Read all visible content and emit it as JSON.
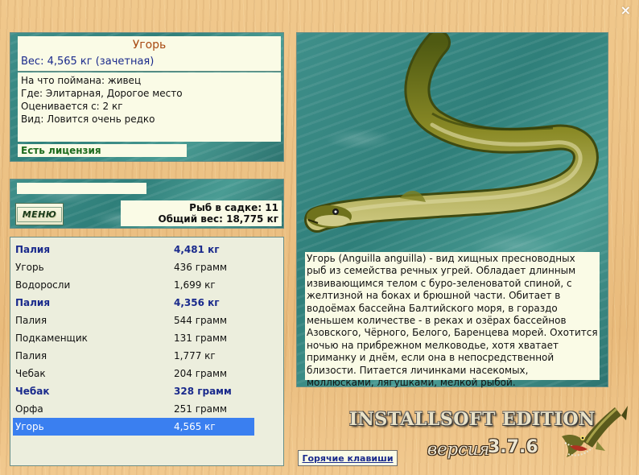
{
  "window": {
    "close_symbol": "×"
  },
  "fish_info": {
    "name": "Угорь",
    "weight": "Вес: 4,565 кг (зачетная)",
    "details": [
      "На что поймана: живец",
      "Где: Элитарная, Дорогое место",
      "Оценивается с: 2 кг",
      "Вид: Ловится очень редко"
    ],
    "license": "Есть лицензия"
  },
  "menu": {
    "button_label": "МЕНЮ",
    "fish_in_cage": "Рыб в садке: 11",
    "total_weight": "Общий вес: 18,775 кг"
  },
  "catch_list": [
    {
      "name": "Палия",
      "weight": "4,481 кг",
      "bold": true
    },
    {
      "name": "Угорь",
      "weight": "436 грамм",
      "bold": false
    },
    {
      "name": "Водоросли",
      "weight": "1,699 кг",
      "bold": false
    },
    {
      "name": "Палия",
      "weight": "4,356 кг",
      "bold": true
    },
    {
      "name": "Палия",
      "weight": "544 грамм",
      "bold": false
    },
    {
      "name": "Подкаменщик",
      "weight": "131 грамм",
      "bold": false
    },
    {
      "name": "Палия",
      "weight": "1,777 кг",
      "bold": false
    },
    {
      "name": "Чебак",
      "weight": "204 грамм",
      "bold": false
    },
    {
      "name": "Чебак",
      "weight": "328 грамм",
      "bold": true
    },
    {
      "name": "Орфа",
      "weight": "251 грамм",
      "bold": false
    },
    {
      "name": "Угорь",
      "weight": "4,565 кг",
      "bold": false,
      "selected": true
    }
  ],
  "description": "Угорь (Anguilla anguilla) - вид хищных пресноводных рыб из семейства речных угрей. Обладает длинным извивающимся телом с буро-зеленоватой спиной, с желтизной на боках и брюшной части. Обитает в водоёмах бассейна Балтийского моря, в гораздо меньшем количестве - в реках и озёрах бассейнов Азовского, Чёрного, Белого, Баренцева морей. Охотится ночью на прибрежном мелководье, хотя хватает приманку и днём, если она в непосредственной близости. Питается личинками насекомых, моллюсками, лягушками, мелкой рыбой.",
  "hotkeys_label": "Горячие клавиши",
  "branding": {
    "edition": "INSTALLSOFT EDITION",
    "version_label": "версия",
    "version_number": "3.7.6"
  },
  "icons": {
    "close": "close-icon",
    "eel": "eel-image",
    "pike": "pike-logo-icon"
  },
  "colors": {
    "highlight_text": "#1a2a8c",
    "fish_name": "#a84a12",
    "license": "#1d6b1d",
    "selection": "#3a7ff0",
    "panel_bg": "#fafbe6"
  }
}
